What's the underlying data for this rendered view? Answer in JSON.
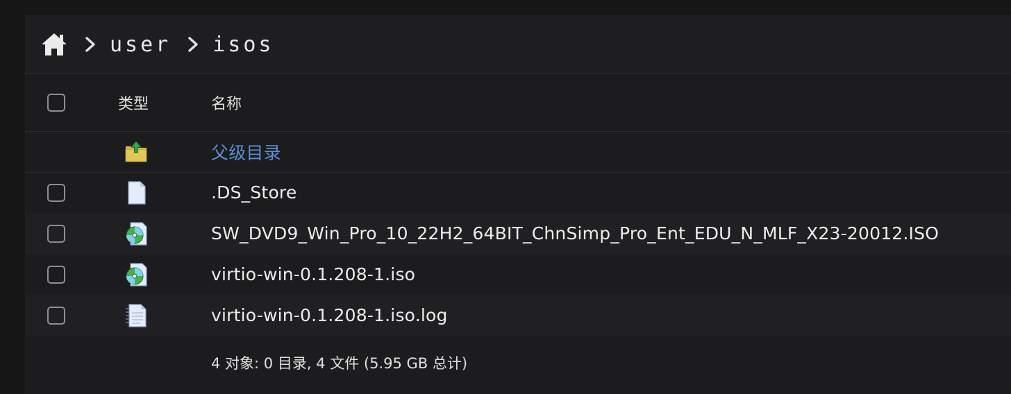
{
  "breadcrumb": {
    "home_icon": "home-icon",
    "items": [
      "user",
      "isos"
    ]
  },
  "table": {
    "headers": {
      "type": "类型",
      "name": "名称"
    },
    "parent_label": "父级目录",
    "rows": [
      {
        "name": ".DS_Store",
        "icon": "generic-file-icon"
      },
      {
        "name": "SW_DVD9_Win_Pro_10_22H2_64BIT_ChnSimp_Pro_Ent_EDU_N_MLF_X23-20012.ISO",
        "icon": "disc-image-icon"
      },
      {
        "name": "virtio-win-0.1.208-1.iso",
        "icon": "disc-image-icon"
      },
      {
        "name": "virtio-win-0.1.208-1.iso.log",
        "icon": "text-file-icon"
      }
    ]
  },
  "summary": "4 对象: 0 目录, 4 文件 (5.95 GB 总计)",
  "colors": {
    "background": "#161617",
    "panel": "#1c1c1e",
    "link": "#5b8fd0",
    "text": "#ededed"
  }
}
